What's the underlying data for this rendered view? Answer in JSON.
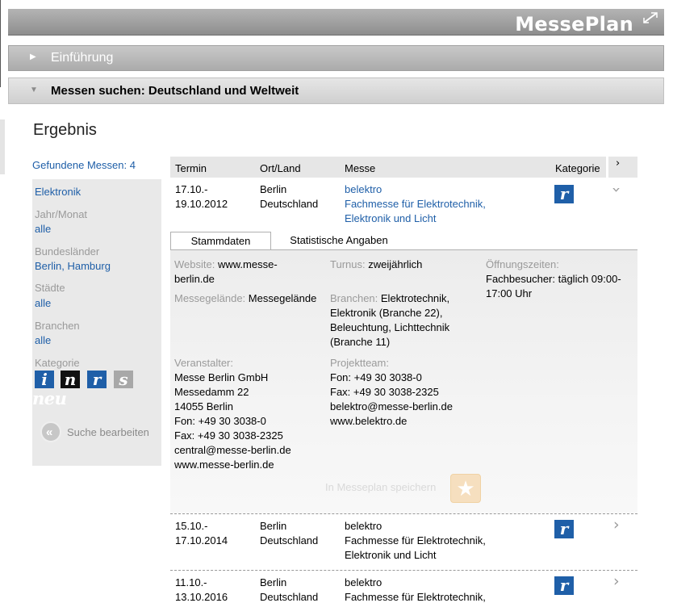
{
  "header": {
    "brand": "MessePlan"
  },
  "sections": {
    "intro": "Einführung",
    "search": "Messen suchen: Deutschland und Weltweit"
  },
  "page_title": "Ergebnis",
  "found_label": "Gefundene Messen: 4",
  "filter": {
    "topic": "Elektronik",
    "year_label": "Jahr/Monat",
    "year_value": "alle",
    "states_label": "Bundesländer",
    "states_value": "Berlin, Hamburg",
    "cities_label": "Städte",
    "cities_value": "alle",
    "branches_label": "Branchen",
    "branches_value": "alle",
    "category_label": "Kategorie",
    "categories": [
      "i",
      "n",
      "r",
      "s"
    ],
    "new_badge": "neu",
    "edit_search": "Suche bearbeiten"
  },
  "table": {
    "headers": {
      "date": "Termin",
      "place": "Ort/Land",
      "fair": "Messe",
      "category": "Kategorie"
    },
    "rows": [
      {
        "date1": "17.10.-",
        "date2": "19.10.2012",
        "city": "Berlin",
        "country": "Deutschland",
        "name": "belektro",
        "desc1": "Fachmesse für Elektrotechnik,",
        "desc2": "Elektronik und Licht",
        "category": "r"
      },
      {
        "date1": "15.10.-",
        "date2": "17.10.2014",
        "city": "Berlin",
        "country": "Deutschland",
        "name": "belektro",
        "desc1": "Fachmesse für Elektrotechnik,",
        "desc2": "Elektronik und Licht",
        "category": "r"
      },
      {
        "date1": "11.10.-",
        "date2": "13.10.2016",
        "city": "Berlin",
        "country": "Deutschland",
        "name": "belektro",
        "desc1": "Fachmesse für Elektrotechnik,",
        "desc2": "",
        "category": "r"
      }
    ]
  },
  "detail": {
    "tabs": {
      "active": "Stammdaten",
      "inactive": "Statistische Angaben"
    },
    "website_label": "Website:",
    "website_value1": "www.messe-",
    "website_value2": "berlin.de",
    "turnus_label": "Turnus:",
    "turnus_value": "zweijährlich",
    "hours_label": "Öffnungszeiten:",
    "hours_value1": "Fachbesucher: täglich 09:00-",
    "hours_value2": "17:00 Uhr",
    "venue_label": "Messegelände:",
    "venue_value": "Messegelände",
    "branches_label": "Branchen:",
    "branches_lines": [
      "Elektrotechnik,",
      "Elektronik (Branche 22),",
      "Beleuchtung, Lichttechnik",
      "(Branche 11)"
    ],
    "organizer_label": "Veranstalter:",
    "organizer_lines": [
      "Messe Berlin GmbH",
      "Messedamm 22",
      "14055 Berlin",
      "Fon: +49 30 3038-0",
      "Fax: +49 30 3038-2325",
      "central@messe-berlin.de",
      "www.messe-berlin.de"
    ],
    "team_label": "Projektteam:",
    "team_lines": [
      "Fon: +49 30 3038-0",
      "Fax: +49 30 3038-2325",
      "belektro@messe-berlin.de",
      "www.belektro.de"
    ],
    "save_label": "In Messeplan speichern"
  },
  "colors": {
    "link": "#1f5fa8",
    "category_r": "#1f5fa8",
    "category_i": "#1f5fa8",
    "category_n": "#111111",
    "category_s": "#a8a8a8"
  }
}
